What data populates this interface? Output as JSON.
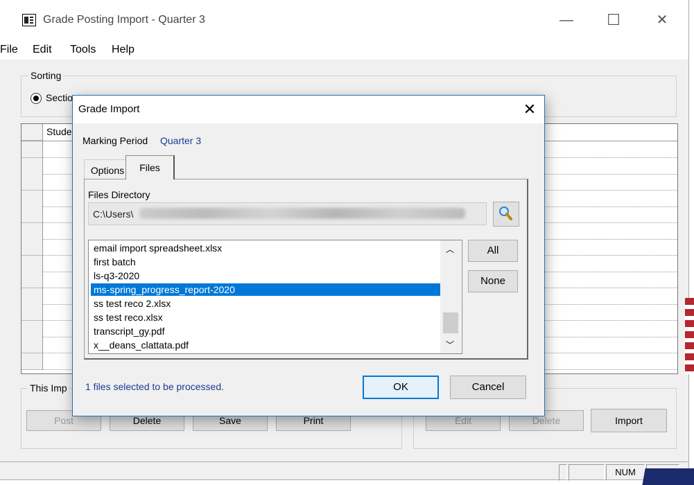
{
  "window": {
    "title": "Grade Posting Import - Quarter 3",
    "minimize": "—",
    "maximize": "☐",
    "close": "✕"
  },
  "menu": [
    "File",
    "Edit",
    "Tools",
    "Help"
  ],
  "sorting": {
    "label": "Sorting",
    "options": [
      "Sectio",
      "",
      ""
    ],
    "selected_index": 0
  },
  "grid": {
    "first_header": "Stude",
    "row_count": 14
  },
  "bottom_left": {
    "label": "This Imp",
    "buttons": {
      "post": "Post",
      "delete": "Delete",
      "save": "Save",
      "print": "Print"
    }
  },
  "bottom_right": {
    "buttons": {
      "edit": "Edit",
      "delete": "Delete",
      "import": "Import"
    }
  },
  "status": {
    "num": "NUM"
  },
  "dialog": {
    "title": "Grade Import",
    "close": "✕",
    "marking_period_label": "Marking Period",
    "marking_period_value": "Quarter 3",
    "tabs": {
      "options": "Options",
      "files": "Files"
    },
    "files_directory_label": "Files Directory",
    "files_directory_value": "C:\\Users\\",
    "files": [
      "email import spreadsheet.xlsx",
      "first batch",
      "ls-q3-2020",
      "ms-spring_progress_report-2020",
      "ss test reco 2.xlsx",
      "ss test reco.xlsx",
      "transcript_gy.pdf",
      "x__deans_clattata.pdf"
    ],
    "selected_file_index": 3,
    "all_button": "All",
    "none_button": "None",
    "status_text": "1 files selected to be processed.",
    "ok_button": "OK",
    "cancel_button": "Cancel",
    "colors": {
      "accent": "#0078d7",
      "link_text": "#1f3a93"
    }
  }
}
